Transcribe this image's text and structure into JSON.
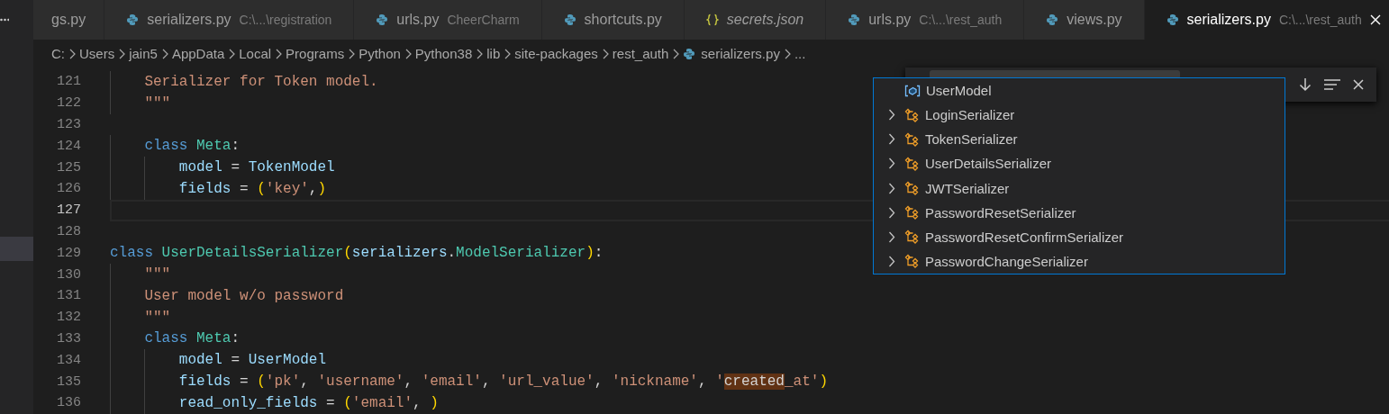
{
  "tabs": [
    {
      "label": "gs.py",
      "selected": false,
      "preview": false
    },
    {
      "label": "serializers.py",
      "description": "C:\\...\\registration",
      "kind": "python",
      "selected": false,
      "preview": false
    },
    {
      "label": "urls.py",
      "description": "CheerCharm",
      "kind": "python",
      "selected": false,
      "preview": false
    },
    {
      "label": "shortcuts.py",
      "kind": "python",
      "selected": false,
      "preview": false
    },
    {
      "label": "secrets.json",
      "kind": "json",
      "selected": false,
      "preview": true
    },
    {
      "label": "urls.py",
      "description": "C:\\...\\rest_auth",
      "kind": "python",
      "selected": false,
      "preview": false
    },
    {
      "label": "views.py",
      "kind": "python",
      "selected": false,
      "preview": false
    },
    {
      "label": "serializers.py",
      "description": "C:\\...\\rest_auth",
      "kind": "python",
      "selected": true,
      "preview": false
    }
  ],
  "breadcrumb": [
    {
      "label": "C:",
      "kind": "folder"
    },
    {
      "label": "Users",
      "kind": "folder"
    },
    {
      "label": "jain5",
      "kind": "folder"
    },
    {
      "label": "AppData",
      "kind": "folder"
    },
    {
      "label": "Local",
      "kind": "folder"
    },
    {
      "label": "Programs",
      "kind": "folder"
    },
    {
      "label": "Python",
      "kind": "folder"
    },
    {
      "label": "Python38",
      "kind": "folder"
    },
    {
      "label": "lib",
      "kind": "folder"
    },
    {
      "label": "site-packages",
      "kind": "folder"
    },
    {
      "label": "rest_auth",
      "kind": "folder"
    },
    {
      "label": "serializers.py",
      "kind": "python"
    },
    {
      "label": "...",
      "kind": "more"
    }
  ],
  "sidebar": {
    "items": [
      {
        "selected": true
      }
    ]
  },
  "lines": [
    {
      "number": "121",
      "current": false,
      "tokens": [
        {
          "kind": "doc",
          "text": "    Serializer for Token model."
        }
      ]
    },
    {
      "number": "122",
      "current": false,
      "tokens": [
        {
          "kind": "doc",
          "text": "    \"\"\""
        }
      ]
    },
    {
      "number": "123",
      "current": false
    },
    {
      "number": "124",
      "current": false,
      "tokens": [
        {
          "kind": "keyword",
          "text": "    class "
        },
        {
          "kind": "type",
          "text": "Meta"
        },
        {
          "kind": "plain",
          "text": ":"
        }
      ]
    },
    {
      "number": "125",
      "current": false,
      "tokens": [
        {
          "kind": "var",
          "text": "        model"
        },
        {
          "kind": "plain",
          "text": " = "
        },
        {
          "kind": "var",
          "text": "TokenModel"
        }
      ]
    },
    {
      "number": "126",
      "current": false,
      "tokens": [
        {
          "kind": "var",
          "text": "        fields"
        },
        {
          "kind": "plain",
          "text": " = "
        },
        {
          "kind": "bracket",
          "text": "("
        },
        {
          "kind": "string",
          "text": "'key'"
        },
        {
          "kind": "plain",
          "text": ","
        },
        {
          "kind": "bracket",
          "text": ")"
        }
      ]
    },
    {
      "number": "127",
      "current": true
    },
    {
      "number": "128",
      "current": false
    },
    {
      "number": "129",
      "current": false,
      "tokens": [
        {
          "kind": "keyword",
          "text": "class "
        },
        {
          "kind": "type",
          "text": "UserDetailsSerializer"
        },
        {
          "kind": "bracket",
          "text": "("
        },
        {
          "kind": "var",
          "text": "serializers"
        },
        {
          "kind": "plain",
          "text": "."
        },
        {
          "kind": "type",
          "text": "ModelSerializer"
        },
        {
          "kind": "bracket",
          "text": ")"
        },
        {
          "kind": "plain",
          "text": ":"
        }
      ]
    },
    {
      "number": "130",
      "current": false,
      "tokens": [
        {
          "kind": "doc",
          "text": "    \"\"\""
        }
      ]
    },
    {
      "number": "131",
      "current": false,
      "tokens": [
        {
          "kind": "doc",
          "text": "    User model w/o password"
        }
      ]
    },
    {
      "number": "132",
      "current": false,
      "tokens": [
        {
          "kind": "doc",
          "text": "    \"\"\""
        }
      ]
    },
    {
      "number": "133",
      "current": false,
      "tokens": [
        {
          "kind": "keyword",
          "text": "    class "
        },
        {
          "kind": "type",
          "text": "Meta"
        },
        {
          "kind": "plain",
          "text": ":"
        }
      ]
    },
    {
      "number": "134",
      "current": false,
      "tokens": [
        {
          "kind": "var",
          "text": "        model"
        },
        {
          "kind": "plain",
          "text": " = "
        },
        {
          "kind": "var",
          "text": "UserModel"
        }
      ]
    },
    {
      "number": "135",
      "current": false,
      "tokens": [
        {
          "kind": "var",
          "text": "        fields"
        },
        {
          "kind": "plain",
          "text": " = "
        },
        {
          "kind": "bracket",
          "text": "("
        },
        {
          "kind": "string",
          "text": "'pk'"
        },
        {
          "kind": "plain",
          "text": ", "
        },
        {
          "kind": "string",
          "text": "'username'"
        },
        {
          "kind": "plain",
          "text": ", "
        },
        {
          "kind": "string",
          "text": "'email'"
        },
        {
          "kind": "plain",
          "text": ", "
        },
        {
          "kind": "string",
          "text": "'url_value'"
        },
        {
          "kind": "plain",
          "text": ", "
        },
        {
          "kind": "string",
          "text": "'nickname'"
        },
        {
          "kind": "plain",
          "text": ", "
        },
        {
          "kind": "string",
          "text": "'"
        },
        {
          "kind": "match",
          "text": "created"
        },
        {
          "kind": "string",
          "text": "_at'"
        },
        {
          "kind": "bracket",
          "text": ")"
        }
      ]
    },
    {
      "number": "136",
      "current": false,
      "tokens": [
        {
          "kind": "var",
          "text": "        read_only_fields"
        },
        {
          "kind": "plain",
          "text": " = "
        },
        {
          "kind": "bracket",
          "text": "("
        },
        {
          "kind": "string",
          "text": "'email'"
        },
        {
          "kind": "plain",
          "text": ", "
        },
        {
          "kind": "bracket",
          "text": ")"
        }
      ]
    }
  ],
  "outline": {
    "items": [
      {
        "label": "UserModel",
        "kind": "variable"
      },
      {
        "label": "LoginSerializer",
        "kind": "class"
      },
      {
        "label": "TokenSerializer",
        "kind": "class"
      },
      {
        "label": "UserDetailsSerializer",
        "kind": "class"
      },
      {
        "label": "JWTSerializer",
        "kind": "class"
      },
      {
        "label": "PasswordResetSerializer",
        "kind": "class"
      },
      {
        "label": "PasswordResetConfirmSerializer",
        "kind": "class"
      },
      {
        "label": "PasswordChangeSerializer",
        "kind": "class"
      }
    ]
  }
}
